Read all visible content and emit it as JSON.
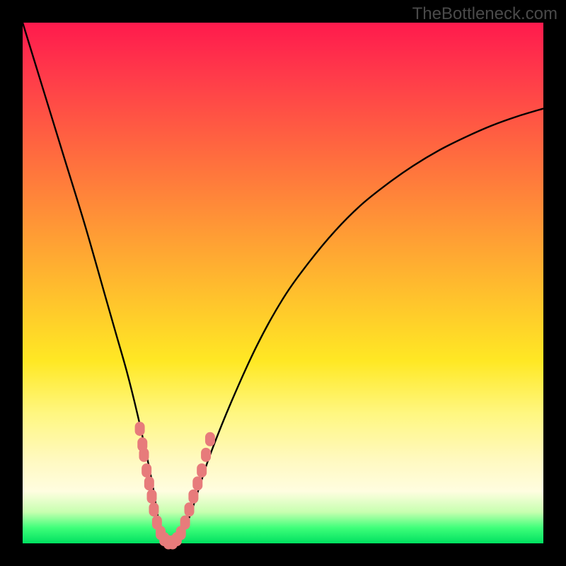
{
  "watermark": "TheBottleneck.com",
  "colors": {
    "frame": "#000000",
    "curve": "#000000",
    "markers": "#e77b7b",
    "gradient_top": "#ff1a4d",
    "gradient_bottom": "#00e060"
  },
  "chart_data": {
    "type": "line",
    "title": "",
    "xlabel": "",
    "ylabel": "",
    "xlim": [
      0,
      100
    ],
    "ylim": [
      0,
      100
    ],
    "series": [
      {
        "name": "bottleneck-curve",
        "x": [
          0,
          4,
          8,
          12,
          16,
          18,
          20,
          22,
          24,
          25,
          26,
          27,
          28,
          29,
          30,
          32,
          34,
          36,
          40,
          45,
          50,
          55,
          60,
          65,
          70,
          75,
          80,
          85,
          90,
          95,
          100
        ],
        "values": [
          100,
          87,
          74,
          61,
          47,
          40,
          33,
          25,
          16,
          11,
          5,
          1,
          0,
          0,
          1,
          5,
          11,
          17,
          27,
          38,
          47,
          54,
          60,
          65,
          69,
          72.5,
          75.5,
          78,
          80.2,
          82,
          83.5
        ]
      }
    ],
    "markers": {
      "name": "highlighted-points",
      "x": [
        22.5,
        23.0,
        23.3,
        23.8,
        24.3,
        24.8,
        25.2,
        25.8,
        26.5,
        27.2,
        28.0,
        28.8,
        29.6,
        30.4,
        31.2,
        32.0,
        32.8,
        33.6,
        34.4,
        35.2,
        36.0
      ],
      "values": [
        22.0,
        19.0,
        17.0,
        14.0,
        11.5,
        9.0,
        6.5,
        4.0,
        2.0,
        0.8,
        0.2,
        0.2,
        0.8,
        2.0,
        4.0,
        6.5,
        9.0,
        11.5,
        14.0,
        17.0,
        20.0
      ]
    }
  }
}
